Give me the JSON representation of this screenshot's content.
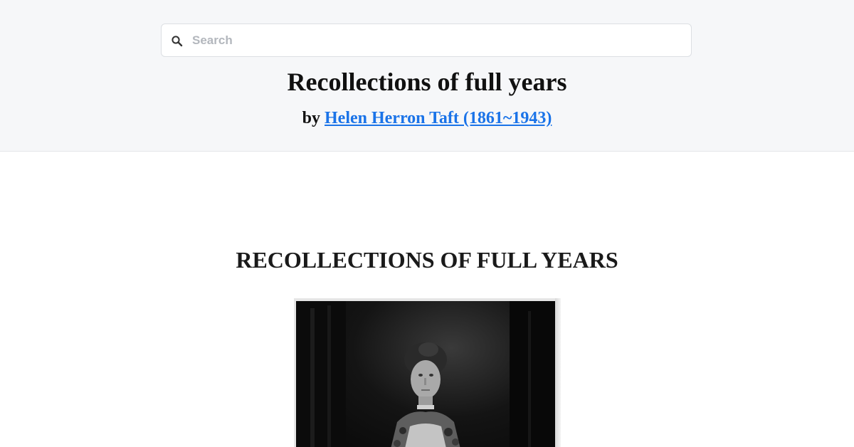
{
  "search": {
    "placeholder": "Search",
    "value": ""
  },
  "book": {
    "title": "Recollections of full years",
    "by_label": "by",
    "author": "Helen Herron Taft (1861~1943)"
  },
  "content": {
    "chapter_title": "RECOLLECTIONS OF FULL YEARS"
  },
  "colors": {
    "header_bg": "#f6f7f9",
    "link": "#1a73e8"
  }
}
